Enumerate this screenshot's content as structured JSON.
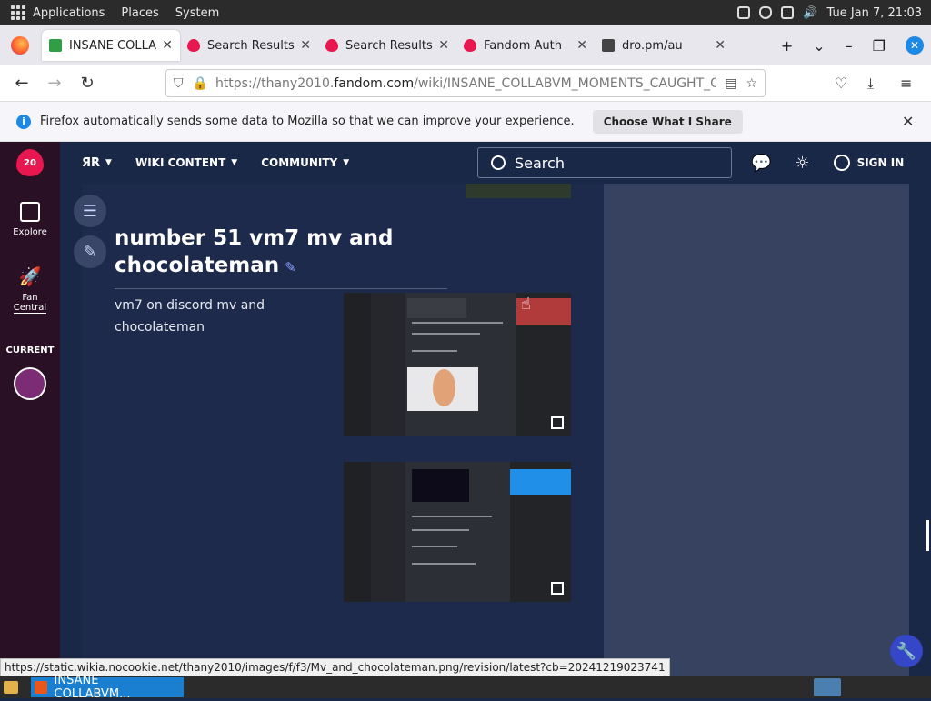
{
  "gnome": {
    "menus": [
      "Applications",
      "Places",
      "System"
    ],
    "clock": "Tue Jan  7, 21:03"
  },
  "tabs": [
    {
      "title": "INSANE COLLABVM MOMENTS",
      "active": true,
      "favicon_color": "#2f9e44"
    },
    {
      "title": "Search Results | Fandom",
      "active": false,
      "favicon_color": "#e8174f"
    },
    {
      "title": "Search Results | Fandom",
      "active": false,
      "favicon_color": "#e8174f"
    },
    {
      "title": "Fandom Auth",
      "active": false,
      "favicon_color": "#e8174f"
    },
    {
      "title": "dro.pm/au",
      "active": false,
      "favicon_color": "#444444"
    }
  ],
  "tab_controls": {
    "new_tab": "+",
    "list_all": "⌄",
    "minimize": "–",
    "restore": "❐",
    "close": "✕"
  },
  "nav": {
    "url_prefix": "https://thany2010.",
    "url_domain": "fandom.com",
    "url_path": "/wiki/INSANE_COLLABVM_MOMENTS_CAUGHT_ON"
  },
  "notification": {
    "text": "Firefox automatically sends some data to Mozilla so that we can improve your experience.",
    "button": "Choose What I Share"
  },
  "sidebar": {
    "logo_text": "20",
    "explore": "Explore",
    "fan_central_1": "Fan",
    "fan_central_2": "Central",
    "current": "CURRENT"
  },
  "topnav": {
    "wiki_content": "WIKI CONTENT",
    "community": "COMMUNITY",
    "search_placeholder": "Search",
    "sign_in": "SIGN IN"
  },
  "article": {
    "heading": "number 51 vm7 mv and chocolateman",
    "paragraph": "vm7 on discord mv and chocolateman"
  },
  "status_url": "https://static.wikia.nocookie.net/thany2010/images/f/f3/Mv_and_chocolateman.png/revision/latest?cb=20241219023741",
  "taskbar": {
    "window_title": "INSANE COLLABVM..."
  }
}
